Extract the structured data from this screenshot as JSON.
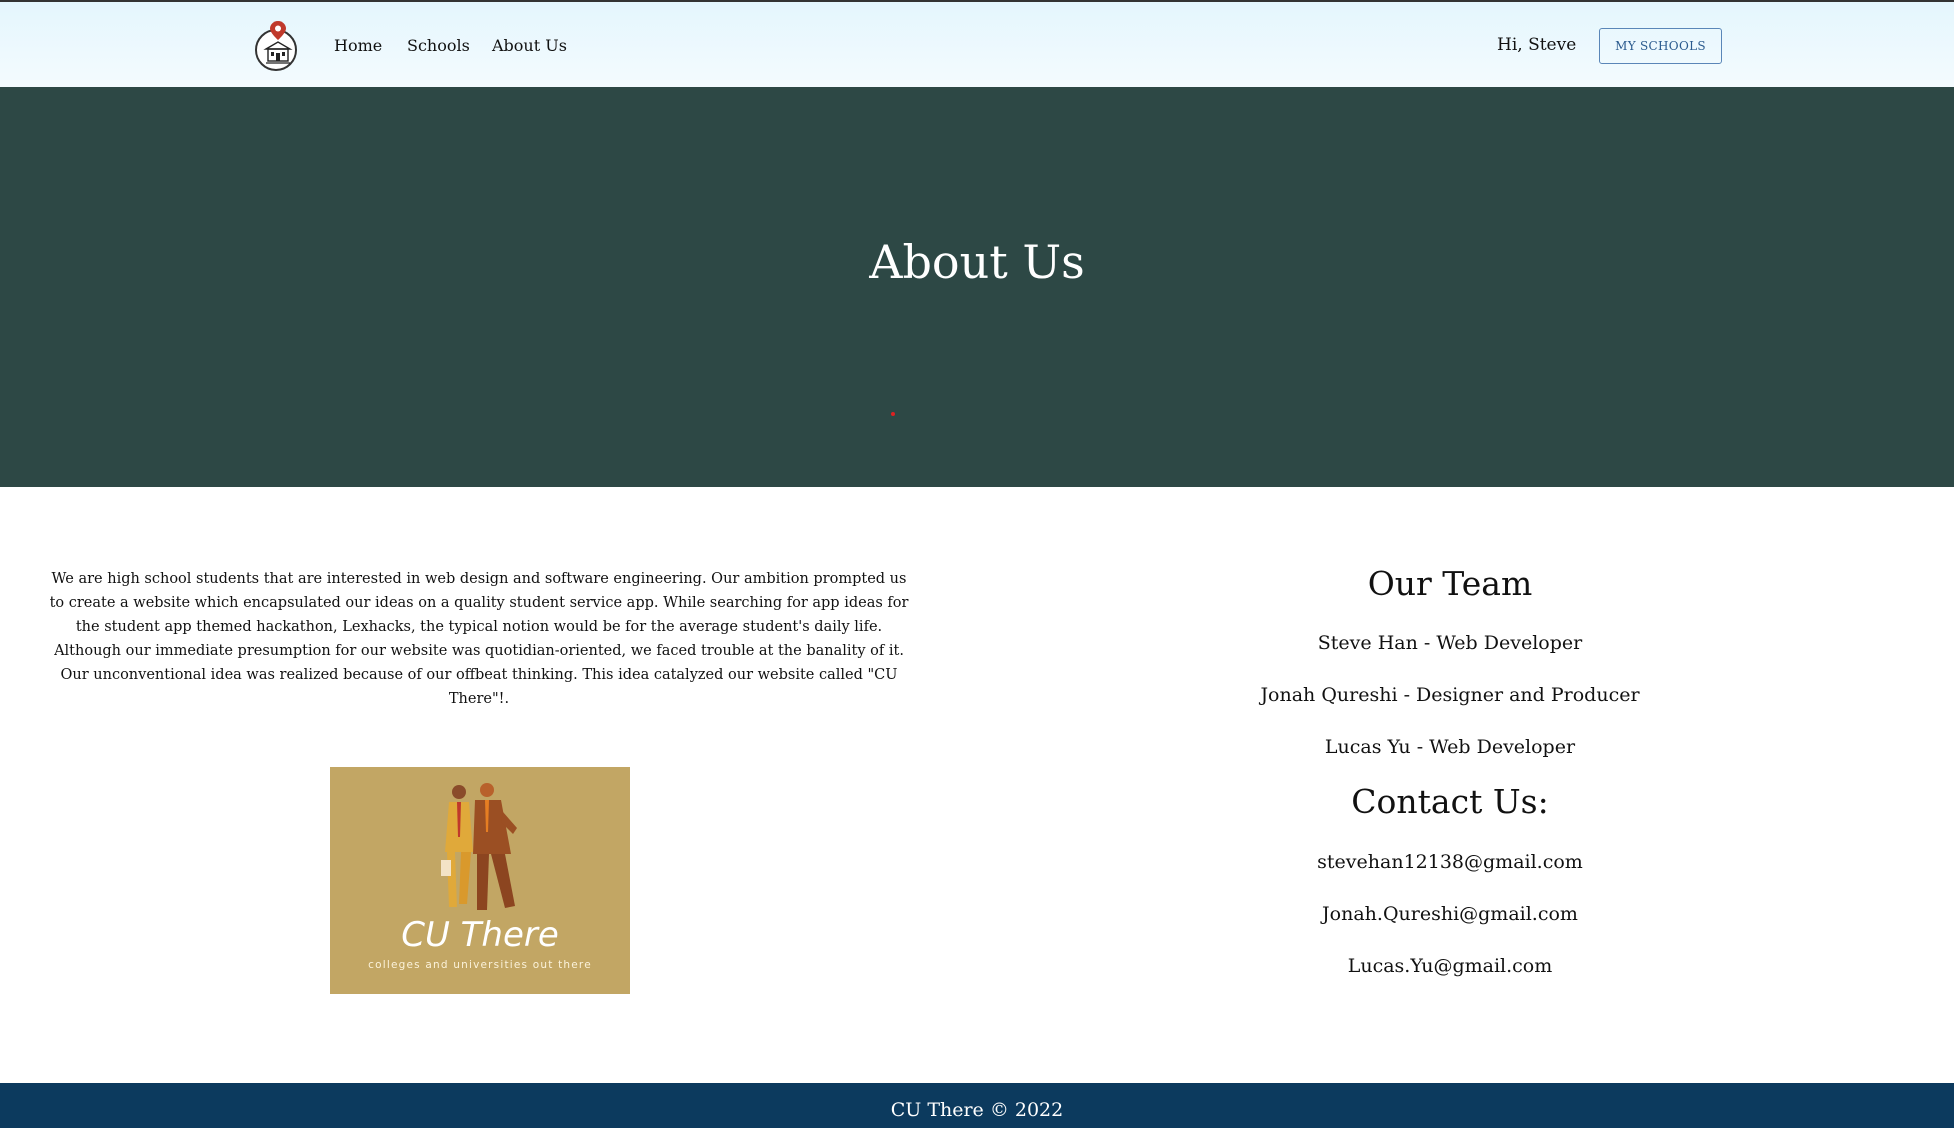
{
  "nav": {
    "links": [
      {
        "label": "Home"
      },
      {
        "label": "Schools"
      },
      {
        "label": "About Us"
      }
    ],
    "greeting": "Hi, Steve",
    "my_schools_label": "MY SCHOOLS"
  },
  "hero": {
    "title": "About Us"
  },
  "about": {
    "paragraph": "We are high school students that are interested in web design and software engineering. Our ambition prompted us to create a website which encapsulated our ideas on a quality student service app. While searching for app ideas for the student app themed hackathon, Lexhacks, the typical notion would be for the average student's daily life. Although our immediate presumption for our website was quotidian-oriented, we faced trouble at the banality of it. Our unconventional idea was realized because of our offbeat thinking. This idea catalyzed our website called \"CU There\"!.",
    "image": {
      "brand_name": "CU There",
      "tagline": "colleges and universities out there"
    }
  },
  "team": {
    "heading": "Our Team",
    "members": [
      "Steve Han - Web Developer",
      "Jonah Qureshi - Designer and Producer",
      "Lucas Yu - Web Developer"
    ]
  },
  "contact": {
    "heading": "Contact Us:",
    "emails": [
      "stevehan12138@gmail.com",
      "Jonah.Qureshi@gmail.com",
      "Lucas.Yu@gmail.com"
    ]
  },
  "footer": {
    "text": "CU There © 2022"
  },
  "colors": {
    "hero_bg": "#2d4845",
    "footer_bg": "#0c3a5e",
    "navbar_bg": "#e4f6fd",
    "button_border": "#5a86b8",
    "image_bg": "#c2a664"
  },
  "icons": {
    "logo": "school-map-pin-logo"
  }
}
